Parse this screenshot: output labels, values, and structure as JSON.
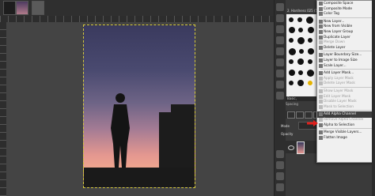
{
  "dock": {
    "brush_header": "2. Hardness 025 (51 x 51)",
    "tab_label": "Basic,",
    "spacing_label": "Spacing",
    "mode_label": "Mode",
    "opacity_label": "Opacity"
  },
  "menu": {
    "items": [
      {
        "label": "Composite Space",
        "disabled": false
      },
      {
        "label": "Composite Mode",
        "disabled": false
      },
      {
        "label": "Color Tag",
        "disabled": false
      },
      {
        "sep": true
      },
      {
        "label": "New Layer...",
        "disabled": false
      },
      {
        "label": "New from Visible",
        "disabled": false
      },
      {
        "label": "New Layer Group",
        "disabled": false
      },
      {
        "label": "Duplicate Layer",
        "disabled": false
      },
      {
        "label": "Merge Down",
        "disabled": true
      },
      {
        "label": "Delete Layer",
        "disabled": false
      },
      {
        "sep": true
      },
      {
        "label": "Layer Boundary Size...",
        "disabled": false
      },
      {
        "label": "Layer to Image Size",
        "disabled": false
      },
      {
        "label": "Scale Layer...",
        "disabled": false
      },
      {
        "sep": true
      },
      {
        "label": "Add Layer Mask...",
        "disabled": false
      },
      {
        "label": "Apply Layer Mask",
        "disabled": true
      },
      {
        "label": "Delete Layer Mask",
        "disabled": true
      },
      {
        "sep": true
      },
      {
        "label": "Show Layer Mask",
        "disabled": true
      },
      {
        "label": "Edit Layer Mask",
        "disabled": true
      },
      {
        "label": "Disable Layer Mask",
        "disabled": true
      },
      {
        "label": "Mask to Selection",
        "disabled": true
      },
      {
        "sep": true
      },
      {
        "label": "Add Alpha Channel",
        "disabled": false,
        "highlight": true
      },
      {
        "label": "Remove Alpha Channel",
        "disabled": true
      },
      {
        "label": "Alpha to Selection",
        "disabled": false
      },
      {
        "sep": true
      },
      {
        "label": "Merge Visible Layers...",
        "disabled": false
      },
      {
        "label": "Flatten Image",
        "disabled": false
      }
    ]
  },
  "colors": {
    "highlight": "#3d3d3d",
    "arrow": "#e0201c",
    "selection_border": "#d7cb3a"
  }
}
